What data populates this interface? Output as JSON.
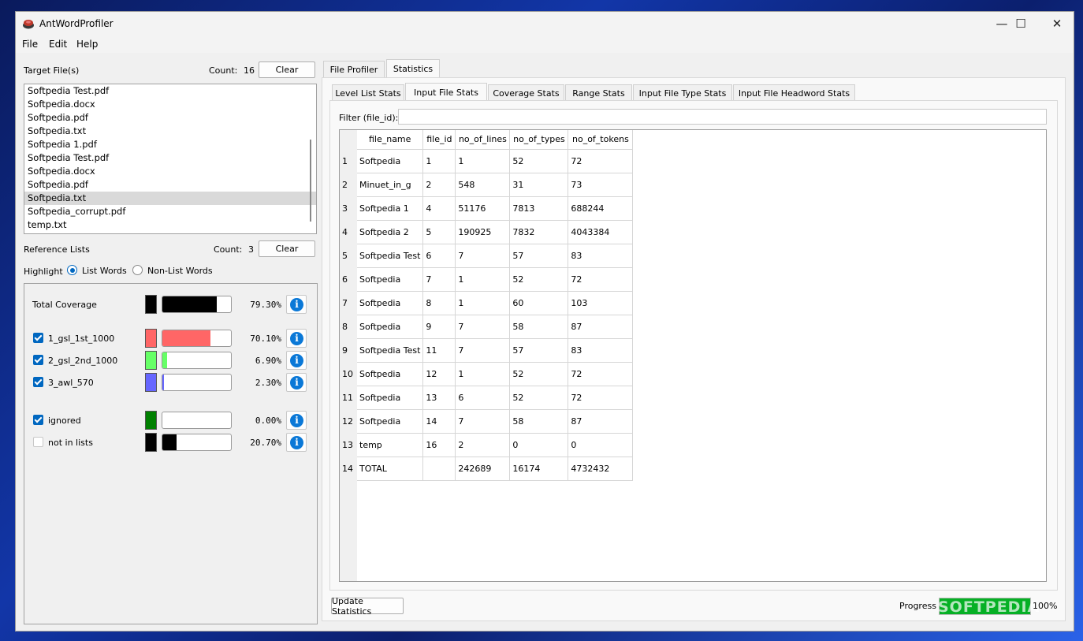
{
  "window": {
    "title": "AntWordProfiler",
    "minimize": "—",
    "maximize": "☐",
    "close": "✕"
  },
  "menu": [
    "File",
    "Edit",
    "Help"
  ],
  "target_files": {
    "label": "Target File(s)",
    "count_label": "Count:",
    "count": "16",
    "clear_label": "Clear",
    "items": [
      "Softpedia Test.pdf",
      "Softpedia.docx",
      "Softpedia.pdf",
      "Softpedia.txt",
      "Softpedia 1.pdf",
      "Softpedia Test.pdf",
      "Softpedia.docx",
      "Softpedia.pdf",
      "Softpedia.txt",
      "Softpedia_corrupt.pdf",
      "temp.txt"
    ],
    "selected_index": 8
  },
  "reference_lists": {
    "label": "Reference Lists",
    "count_label": "Count:",
    "count": "3",
    "clear_label": "Clear",
    "highlight_label": "Highlight",
    "list_words_label": "List Words",
    "non_list_words_label": "Non-List Words",
    "highlight_mode": "List Words"
  },
  "coverage": [
    {
      "label": "Total Coverage",
      "checkbox": null,
      "color": "#000000",
      "fill": 0.793,
      "percent": "79.30%"
    },
    {
      "label": "1_gsl_1st_1000",
      "checkbox": true,
      "color": "#ff6666",
      "fill": 0.701,
      "percent": "70.10%"
    },
    {
      "label": "2_gsl_2nd_1000",
      "checkbox": true,
      "color": "#66ff66",
      "fill": 0.069,
      "percent": "6.90%"
    },
    {
      "label": "3_awl_570",
      "checkbox": true,
      "color": "#6666ff",
      "fill": 0.023,
      "percent": "2.30%"
    },
    {
      "label": "ignored",
      "checkbox": true,
      "color": "#008000",
      "fill": 0.0,
      "percent": "0.00%"
    },
    {
      "label": "not in lists",
      "checkbox": false,
      "color": "#000000",
      "fill": 0.207,
      "percent": "20.70%"
    }
  ],
  "main_tabs": [
    "File Profiler",
    "Statistics"
  ],
  "main_tab_active": "Statistics",
  "sub_tabs": [
    "Level List Stats",
    "Input File Stats",
    "Coverage Stats",
    "Range Stats",
    "Input File Type Stats",
    "Input File Headword Stats"
  ],
  "sub_tab_active": "Input File Stats",
  "filter": {
    "label": "Filter (file_id):",
    "value": ""
  },
  "table": {
    "columns": [
      "file_name",
      "file_id",
      "no_of_lines",
      "no_of_types",
      "no_of_tokens"
    ],
    "rows": [
      [
        "1",
        "Softpedia",
        "1",
        "1",
        "52",
        "72"
      ],
      [
        "2",
        "Minuet_in_g",
        "2",
        "548",
        "31",
        "73"
      ],
      [
        "3",
        "Softpedia 1",
        "4",
        "51176",
        "7813",
        "688244"
      ],
      [
        "4",
        "Softpedia 2",
        "5",
        "190925",
        "7832",
        "4043384"
      ],
      [
        "5",
        "Softpedia Test",
        "6",
        "7",
        "57",
        "83"
      ],
      [
        "6",
        "Softpedia",
        "7",
        "1",
        "52",
        "72"
      ],
      [
        "7",
        "Softpedia",
        "8",
        "1",
        "60",
        "103"
      ],
      [
        "8",
        "Softpedia",
        "9",
        "7",
        "58",
        "87"
      ],
      [
        "9",
        "Softpedia Test",
        "11",
        "7",
        "57",
        "83"
      ],
      [
        "10",
        "Softpedia",
        "12",
        "1",
        "52",
        "72"
      ],
      [
        "11",
        "Softpedia",
        "13",
        "6",
        "52",
        "72"
      ],
      [
        "12",
        "Softpedia",
        "14",
        "7",
        "58",
        "87"
      ],
      [
        "13",
        "temp",
        "16",
        "2",
        "0",
        "0"
      ],
      [
        "14",
        "TOTAL",
        "",
        "242689",
        "16174",
        "4732432"
      ]
    ]
  },
  "footer": {
    "update_label": "Update Statistics",
    "progress_label": "Progress",
    "progress": 1.0,
    "progress_text": "100%",
    "watermark": "SOFTPEDIA"
  },
  "colors": {
    "accent": "#0067c0",
    "progress": "#06b025",
    "info": "#0a78d7"
  }
}
